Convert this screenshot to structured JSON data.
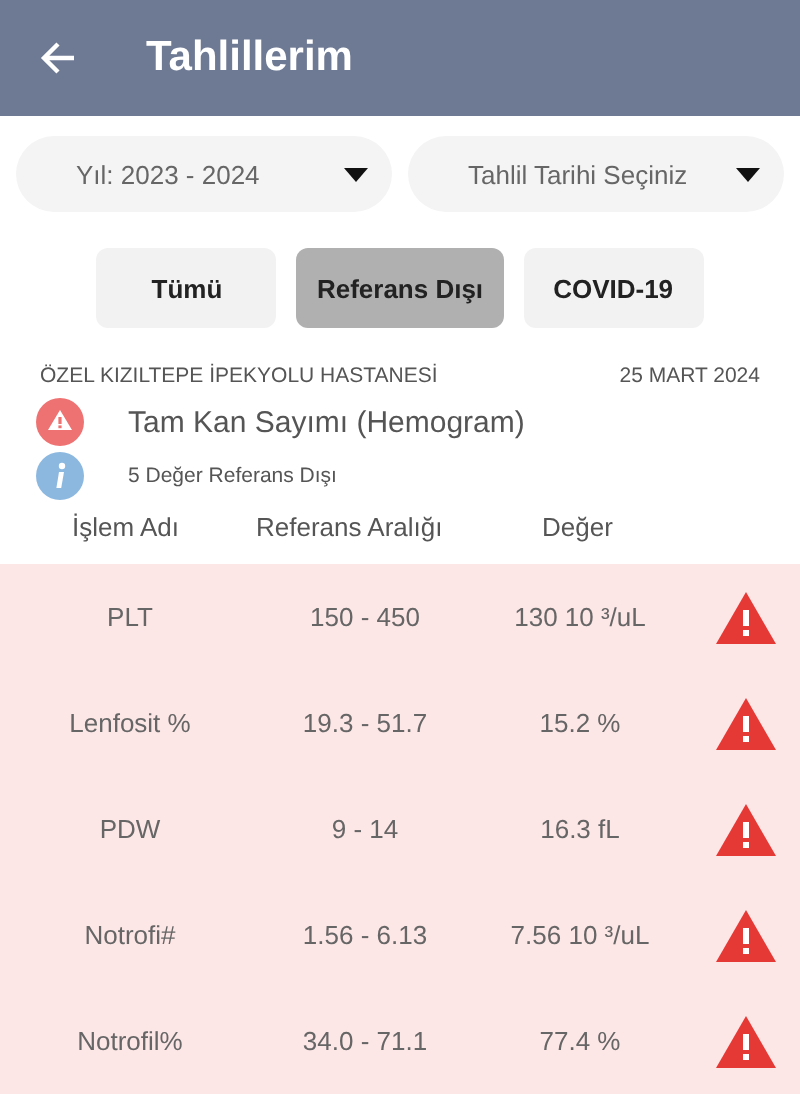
{
  "app_bar": {
    "title": "Tahlillerim"
  },
  "dropdowns": [
    {
      "value": "Yıl: 2023 - 2024"
    },
    {
      "value": "Tahlil Tarihi Seçiniz"
    }
  ],
  "filters": [
    {
      "label": "Tümü",
      "selected": false
    },
    {
      "label": "Referans Dışı",
      "selected": true
    },
    {
      "label": "COVID-19",
      "selected": false
    }
  ],
  "report": {
    "hospital": "ÖZEL KIZILTEPE İPEKYOLU HASTANESİ",
    "date": "25 MART 2024",
    "test_name": "Tam Kan Sayımı (Hemogram)",
    "summary": "5 Değer Referans Dışı"
  },
  "table": {
    "columns": [
      "İşlem Adı",
      "Referans Aralığı",
      "Değer"
    ],
    "rows": [
      {
        "name": "PLT",
        "range": "150 - 450",
        "value": "130 10 ³/uL",
        "abnormal": true
      },
      {
        "name": "Lenfosit %",
        "range": "19.3 - 51.7",
        "value": "15.2 %",
        "abnormal": true
      },
      {
        "name": "PDW",
        "range": "9 - 14",
        "value": "16.3 fL",
        "abnormal": true
      },
      {
        "name": "Notrofi#",
        "range": "1.56 - 6.13",
        "value": "7.56 10 ³/uL",
        "abnormal": true
      },
      {
        "name": "Notrofil%",
        "range": "34.0 - 71.1",
        "value": "77.4 %",
        "abnormal": true
      }
    ]
  }
}
